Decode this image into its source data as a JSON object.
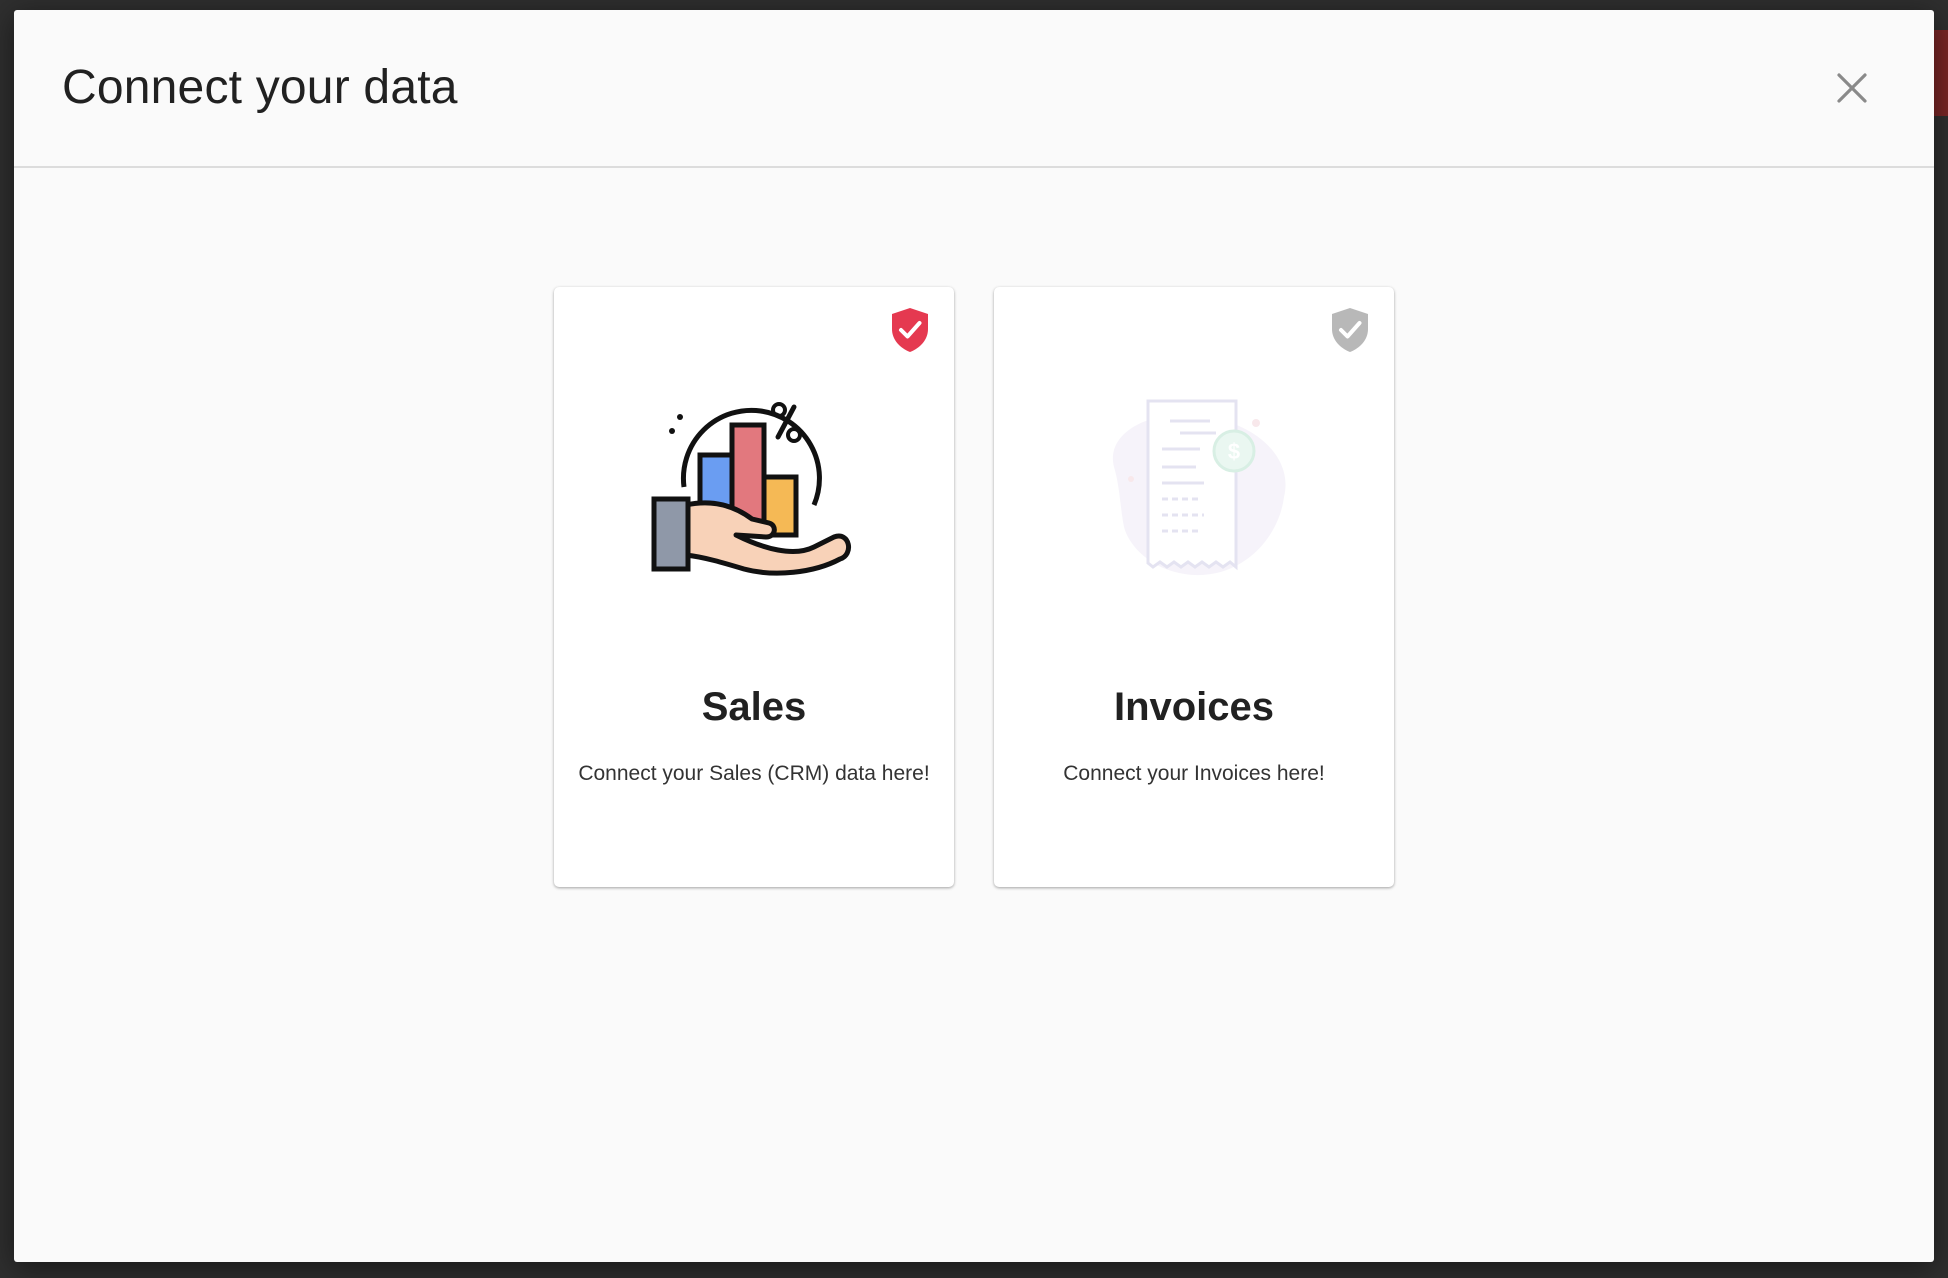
{
  "dialog": {
    "title": "Connect your data",
    "close_icon": "close-icon"
  },
  "cards": [
    {
      "title": "Sales",
      "description": "Connect your Sales (CRM) data here!",
      "icon": "sales-chart-hand-icon",
      "badge_icon": "shield-check-icon",
      "connected": true,
      "badge_color": "#e53950"
    },
    {
      "title": "Invoices",
      "description": "Connect your Invoices here!",
      "icon": "invoice-receipt-icon",
      "badge_icon": "shield-check-icon",
      "connected": false,
      "badge_color": "#b8b8b8"
    }
  ]
}
